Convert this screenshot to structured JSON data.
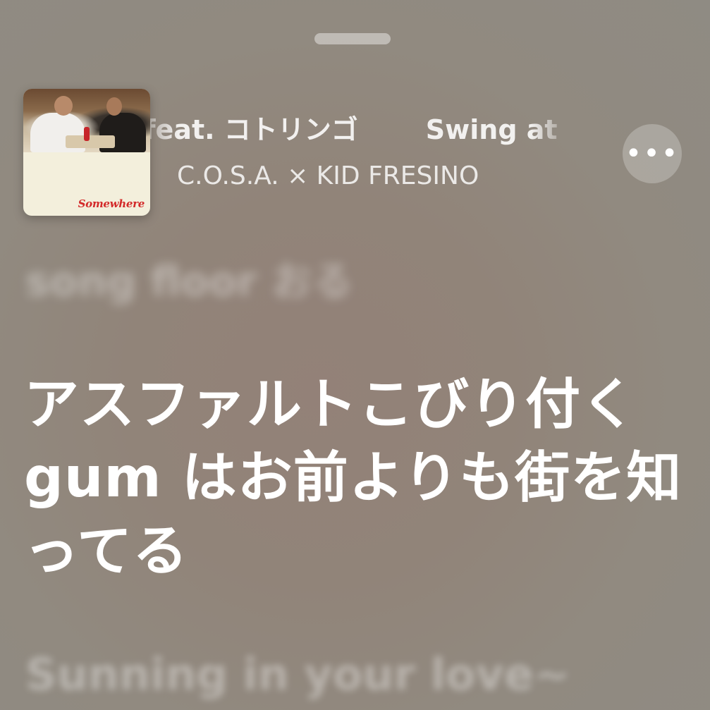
{
  "now_playing": {
    "title_visible": "e feat. コトリンゴ",
    "next_title_visible": "Swing at",
    "artist": "C.O.S.A. × KID FRESINO",
    "album_logo_text": "Somewhere",
    "more_icon": "ellipsis-icon",
    "more_glyph": "•••"
  },
  "lyrics": {
    "previous": "song floor おる",
    "current": "アスファルトこびり付くgum はお前よりも街を知ってる",
    "next": "Sunning in your love~"
  },
  "colors": {
    "background": "#918479",
    "text": "#ffffff",
    "logo_red": "#d32a2a"
  }
}
